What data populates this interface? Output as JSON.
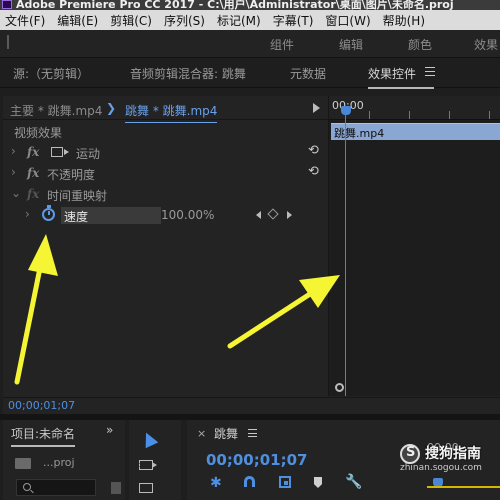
{
  "window": {
    "title": "Adobe Premiere Pro CC 2017 - C:\\用户\\Administrator\\桌面\\图片\\未命名.proj"
  },
  "menubar": {
    "items": [
      "文件(F)",
      "编辑(E)",
      "剪辑(C)",
      "序列(S)",
      "标记(M)",
      "字幕(T)",
      "窗口(W)",
      "帮助(H)"
    ]
  },
  "workspaces": {
    "tabs": [
      "组件",
      "编辑",
      "颜色",
      "效果"
    ]
  },
  "source_tabs": {
    "source": "源:（无剪辑）",
    "audio_mixer": "音频剪辑混合器: 跳舞",
    "metadata": "元数据",
    "effect_controls": "效果控件"
  },
  "effect_controls": {
    "master_clip": "主要 * 跳舞.mp4",
    "chevron": "❯",
    "current_clip": "跳舞 * 跳舞.mp4",
    "section_title": "视频效果",
    "effects": [
      {
        "name": "运动",
        "fx": "fx"
      },
      {
        "name": "不透明度",
        "fx": "fx"
      },
      {
        "name": "时间重映射",
        "fx": "fx"
      }
    ],
    "speed": {
      "label": "速度",
      "value": "100.00%"
    },
    "timecode": "00;00;01;07"
  },
  "timeline": {
    "ruler_label": "00;00",
    "clip_label": "跳舞.mp4"
  },
  "project_panel": {
    "title": "项目:未命名",
    "more": "»",
    "file": "...proj"
  },
  "sequence_panel": {
    "close": "×",
    "name": "跳舞",
    "timecode": "00;00;01;07",
    "ruler_tc": "00;00"
  },
  "watermark": {
    "text": "搜狗指南",
    "url": "zhinan.sogou.com"
  },
  "colors": {
    "accent_blue": "#4f8fe0",
    "annotation_arrow": "#f5f534",
    "clip_bar": "#8aa6d3"
  },
  "icons": {
    "reset": "reset-icon",
    "stopwatch": "stopwatch-icon",
    "search": "search-icon",
    "wrench": "wrench-icon",
    "selection": "selection-tool-icon"
  }
}
